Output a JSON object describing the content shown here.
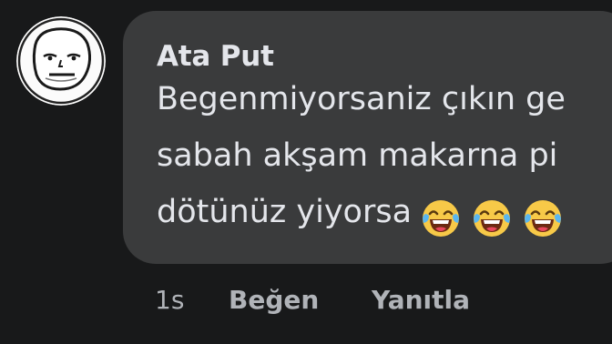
{
  "comment": {
    "author": "Ata Put",
    "text_lines": [
      "Begenmiyorsaniz çıkın ge",
      "sabah akşam makarna pi",
      "dötünüz yiyorsa"
    ],
    "emojis": [
      "laughing-tears-emoji",
      "laughing-tears-emoji",
      "laughing-tears-emoji"
    ]
  },
  "actions": {
    "time": "1s",
    "like_label": "Beğen",
    "reply_label": "Yanıtla"
  },
  "colors": {
    "background": "#18191a",
    "bubble": "#3a3b3c",
    "primary_text": "#e4e6eb",
    "secondary_text": "#b0b3b8"
  }
}
